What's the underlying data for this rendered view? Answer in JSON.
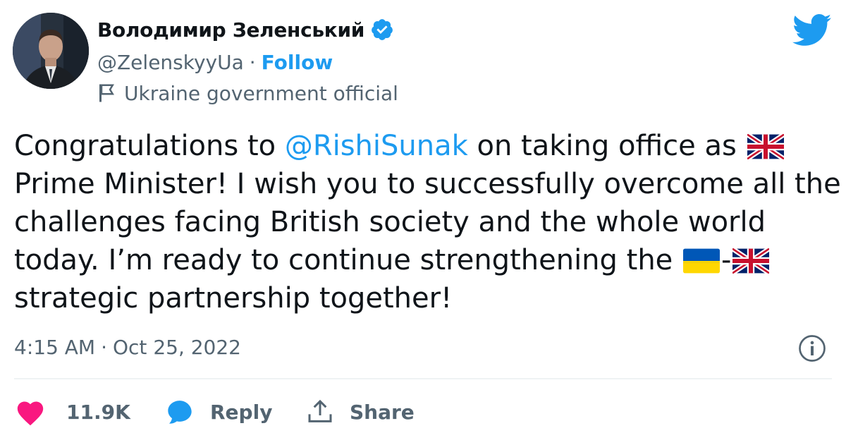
{
  "author": {
    "name": "Володимир Зеленський",
    "handle": "@ZelenskyyUa",
    "separator": "·",
    "follow_label": "Follow",
    "label": "Ukraine government official"
  },
  "tweet": {
    "lines": [
      {
        "before": "Congratulations to ",
        "mention": "@RishiSunak",
        "after": " on taking office as "
      },
      {
        "text": "Prime Minister! I wish you to successfully overcome all the"
      },
      {
        "text": "challenges facing British society and the whole world"
      },
      {
        "before": "today. I’m ready to continue strengthening the ",
        "middle": "-"
      },
      {
        "text": "strategic partnership together!"
      }
    ],
    "emojis": [
      "flag-uk",
      "flag-ukraine",
      "flag-uk"
    ]
  },
  "meta": {
    "time": "4:15 AM",
    "separator": "·",
    "date": "Oct 25, 2022"
  },
  "actions": {
    "likes": "11.9K",
    "reply_label": "Reply",
    "share_label": "Share"
  },
  "colors": {
    "accent": "#1d9bf0",
    "heart": "#f91880",
    "secondary_text": "#536471",
    "text": "#0f1419"
  },
  "icons": {
    "verified": "verified-badge-icon",
    "twitter": "twitter-bird-icon",
    "label": "flag-outline-icon",
    "info": "info-icon",
    "heart": "heart-icon",
    "reply": "reply-bubble-icon",
    "share": "share-icon"
  }
}
